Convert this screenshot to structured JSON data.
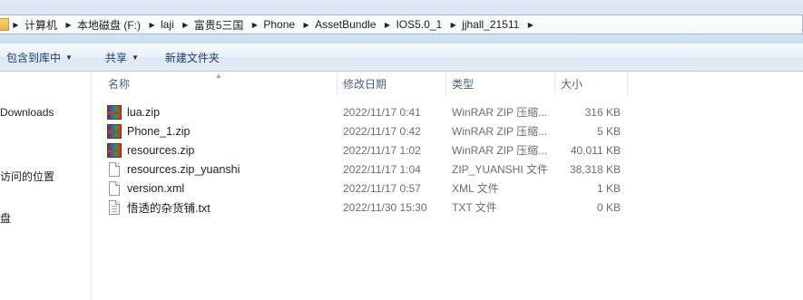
{
  "address_bar": {
    "crumbs": [
      "计算机",
      "本地磁盘 (F:)",
      "laji",
      "富贵5三国",
      "Phone",
      "AssetBundle",
      "IOS5.0_1",
      "jjhall_21511"
    ]
  },
  "toolbar": {
    "organize_label": "包含到库中",
    "share_label": "共享",
    "new_folder_label": "新建文件夹"
  },
  "nav": {
    "items": [
      "Downloads",
      "访问的位置",
      "盘"
    ]
  },
  "columns": {
    "name": "名称",
    "date": "修改日期",
    "type": "类型",
    "size": "大小"
  },
  "files": [
    {
      "name": "lua.zip",
      "date": "2022/11/17 0:41",
      "type": "WinRAR ZIP 压缩...",
      "size": "316 KB",
      "icon": "winrar-archive-icon"
    },
    {
      "name": "Phone_1.zip",
      "date": "2022/11/17 0:42",
      "type": "WinRAR ZIP 压缩...",
      "size": "5 KB",
      "icon": "winrar-archive-icon"
    },
    {
      "name": "resources.zip",
      "date": "2022/11/17 1:02",
      "type": "WinRAR ZIP 压缩...",
      "size": "40,011 KB",
      "icon": "winrar-archive-icon"
    },
    {
      "name": "resources.zip_yuanshi",
      "date": "2022/11/17 1:04",
      "type": "ZIP_YUANSHI 文件",
      "size": "38,318 KB",
      "icon": "blank-file-icon"
    },
    {
      "name": "version.xml",
      "date": "2022/11/17 0:57",
      "type": "XML 文件",
      "size": "1 KB",
      "icon": "blank-file-icon"
    },
    {
      "name": "悟透的杂货铺.txt",
      "date": "2022/11/30 15:30",
      "type": "TXT 文件",
      "size": "0 KB",
      "icon": "text-file-icon"
    }
  ]
}
